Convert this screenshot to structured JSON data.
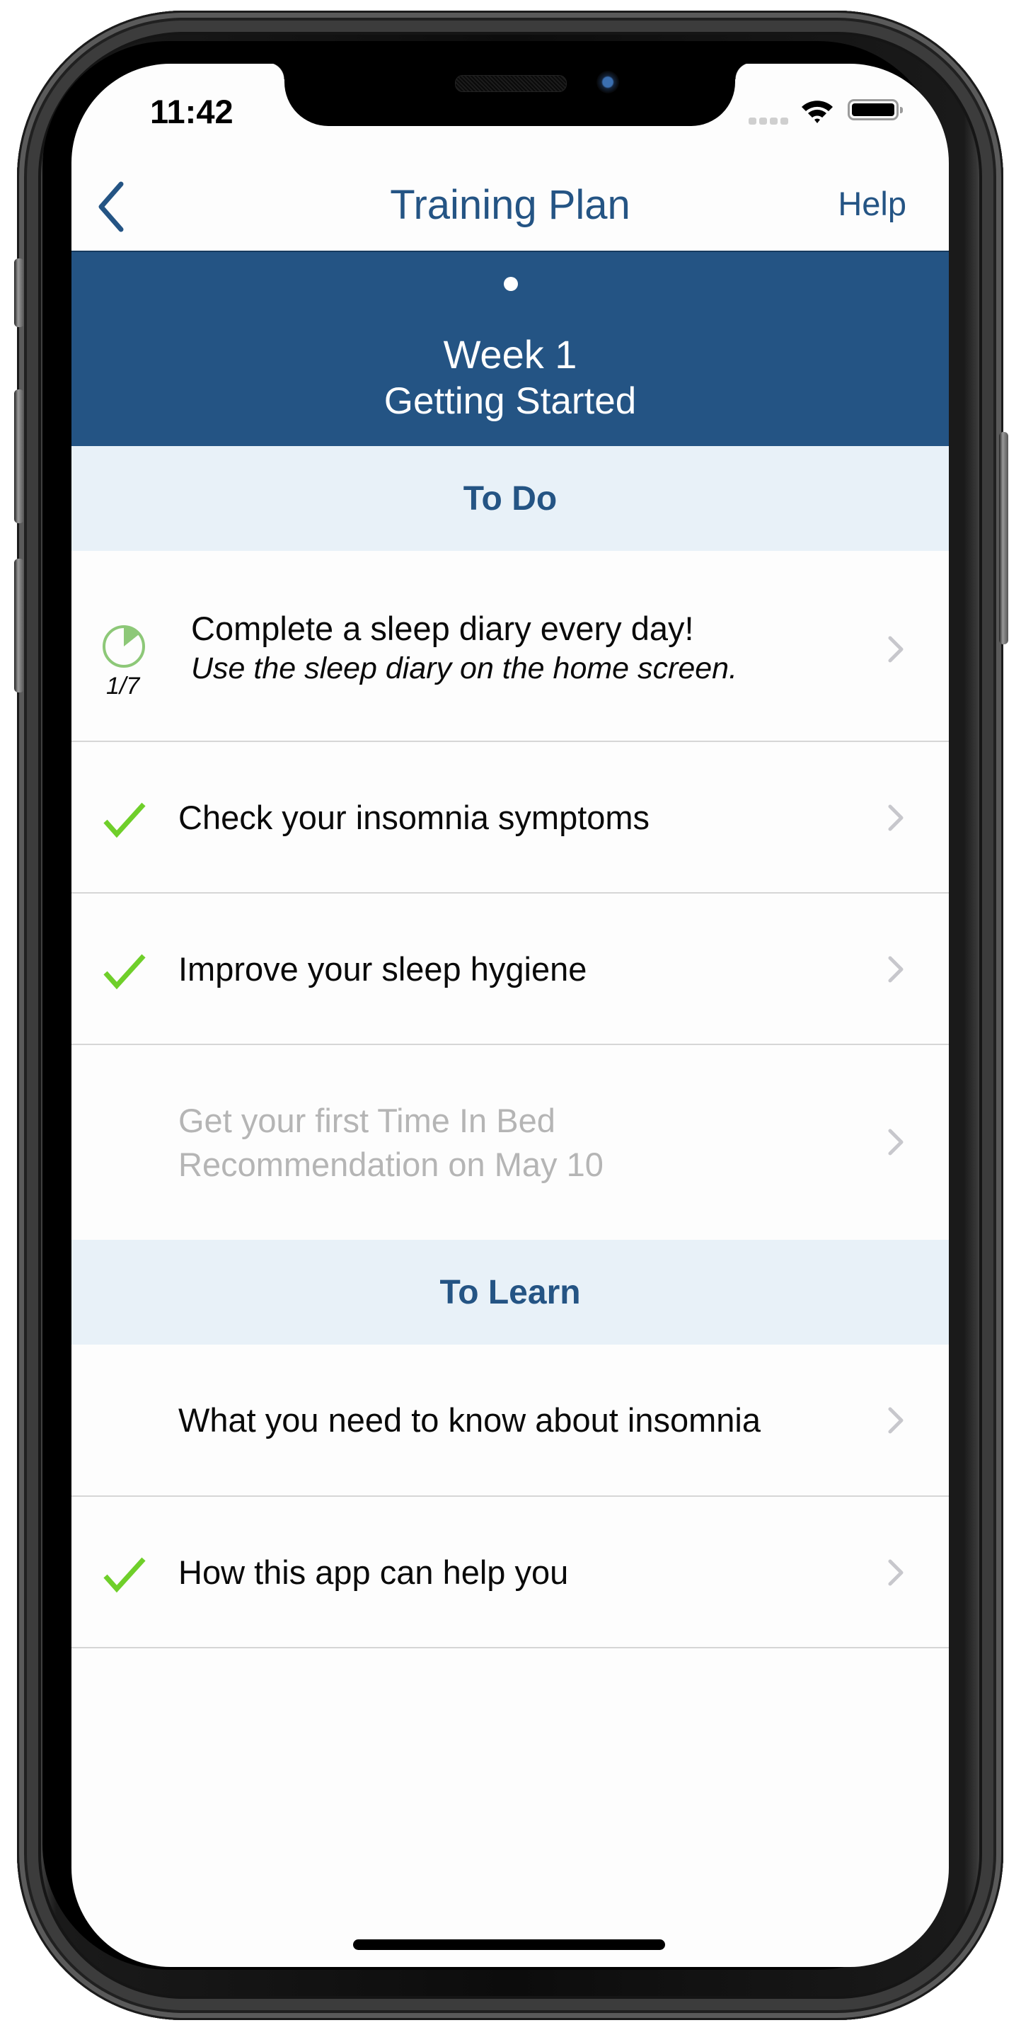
{
  "status_bar": {
    "time": "11:42",
    "signal_icon": "cellular-signal-icon",
    "wifi_icon": "wifi-icon",
    "battery_icon": "battery-icon"
  },
  "navbar": {
    "back_icon": "chevron-left-icon",
    "title": "Training Plan",
    "help_label": "Help"
  },
  "week_header": {
    "page_indicator_count": 1,
    "title": "Week 1",
    "subtitle": "Getting Started"
  },
  "sections": [
    {
      "title": "To Do",
      "items": [
        {
          "title": "Complete a sleep diary every day!",
          "subtitle": "Use the sleep diary on the home screen.",
          "status": "in-progress",
          "progress_done": 1,
          "progress_total": 7,
          "progress_label": "1/7",
          "icon": "progress-pie-icon"
        },
        {
          "title": "Check your insomnia symptoms",
          "status": "done",
          "icon": "checkmark-icon"
        },
        {
          "title": "Improve your sleep hygiene",
          "status": "done",
          "icon": "checkmark-icon"
        },
        {
          "title": "Get your first Time In Bed\nRecommendation on May 10",
          "title_line1": "Get your first Time In Bed",
          "title_line2": "Recommendation on May 10",
          "status": "locked"
        }
      ]
    },
    {
      "title": "To Learn",
      "items": [
        {
          "title": "What you need to know about insomnia",
          "status": "not-done"
        },
        {
          "title": "How this app can help you",
          "status": "done",
          "icon": "checkmark-icon"
        }
      ]
    }
  ],
  "colors": {
    "brand_blue": "#245484",
    "section_band": "#e8f1f8",
    "check_green": "#6fcf2a",
    "progress_green": "#8dc878",
    "muted_text": "#b5b5b5",
    "chevron": "#c7c7cc"
  }
}
